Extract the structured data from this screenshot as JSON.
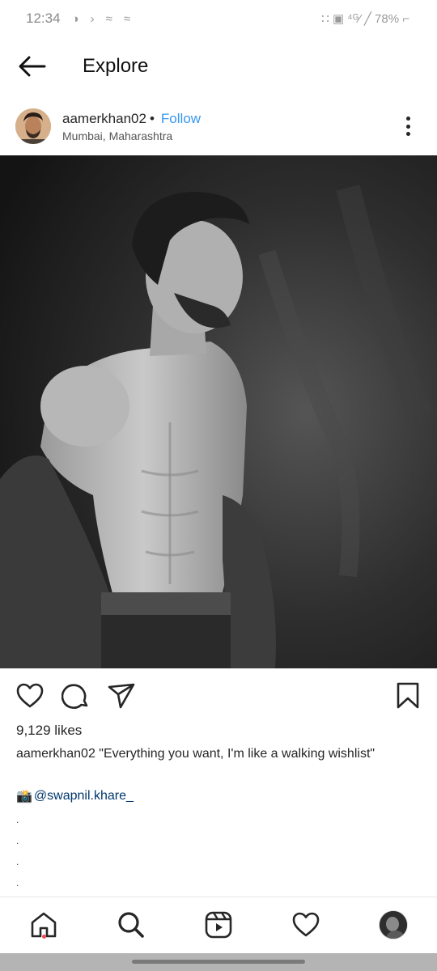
{
  "status_bar": {
    "time": "12:34",
    "left_icons": [
      "◑",
      "›",
      "≈",
      "≈"
    ],
    "right_text": "∷ ▣ ⁴ᴳ⁄ ╱ 78% ⌐"
  },
  "header": {
    "title": "Explore"
  },
  "post": {
    "username": "aamerkhan02",
    "separator": "•",
    "follow_label": "Follow",
    "location": "Mumbai, Maharashtra",
    "likes": "9,129 likes",
    "caption_user": "aamerkhan02",
    "caption_text": "\"Everything you want, I'm like a walking wishlist\"",
    "credit_icon": "📸",
    "credit_text": "@swapnil.khare_",
    "dots": [
      ".",
      ".",
      ".",
      "."
    ]
  },
  "icons": {
    "back": "arrow-left-icon",
    "more": "more-vertical-icon",
    "like": "heart-icon",
    "comment": "comment-icon",
    "share": "send-icon",
    "save": "bookmark-icon",
    "nav": [
      "home-icon",
      "search-icon",
      "reels-icon",
      "activity-heart-icon",
      "profile-avatar"
    ]
  },
  "colors": {
    "follow": "#3897f0",
    "credit": "#00376b",
    "notification_dot": "#ed4956"
  }
}
